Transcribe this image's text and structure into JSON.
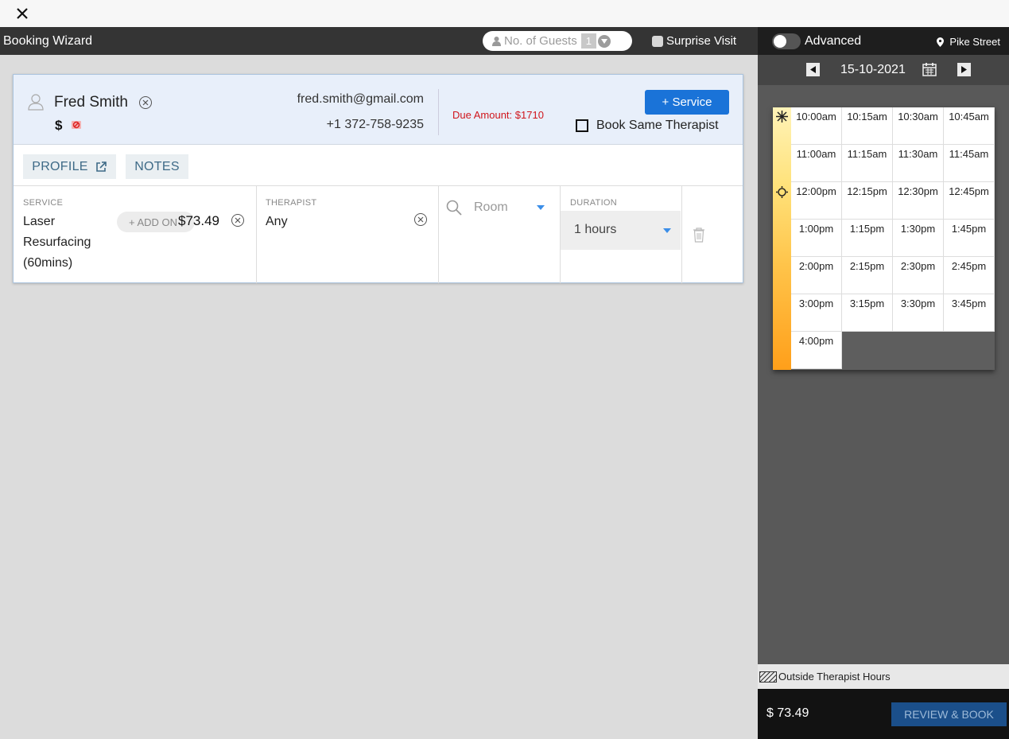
{
  "header": {
    "title": "Booking Wizard",
    "guests_label": "No. of Guests",
    "guests_value": "1",
    "surprise_label": "Surprise Visit"
  },
  "client": {
    "name": "Fred Smith",
    "currency_symbol": "$",
    "email": "fred.smith@gmail.com",
    "phone": "+1 372-758-9235",
    "due_amount": "Due Amount:  $1710",
    "service_button": "+ Service",
    "same_therapist": "Book Same Therapist",
    "profile_tab": "PROFILE",
    "notes_tab": "NOTES"
  },
  "booking": {
    "service_label": "SERVICE",
    "service_value": "Laser Resurfacing (60mins)",
    "addon_label": "+ ADD ON",
    "price": "$73.49",
    "therapist_label": "THERAPIST",
    "therapist_value": "Any",
    "room_placeholder": "Room",
    "duration_label": "DURATION",
    "duration_value": "1 hours"
  },
  "right": {
    "advanced": "Advanced",
    "location": "Pike Street",
    "date": "15-10-2021",
    "slots": [
      [
        "10:00am",
        "10:15am",
        "10:30am",
        "10:45am"
      ],
      [
        "11:00am",
        "11:15am",
        "11:30am",
        "11:45am"
      ],
      [
        "12:00pm",
        "12:15pm",
        "12:30pm",
        "12:45pm"
      ],
      [
        "1:00pm",
        "1:15pm",
        "1:30pm",
        "1:45pm"
      ],
      [
        "2:00pm",
        "2:15pm",
        "2:30pm",
        "2:45pm"
      ],
      [
        "3:00pm",
        "3:15pm",
        "3:30pm",
        "3:45pm"
      ],
      [
        "4:00pm"
      ]
    ],
    "legend": "Outside Therapist Hours",
    "total": "$ 73.49",
    "review_button": "REVIEW & BOOK"
  },
  "colors": {
    "primary": "#1a73d8",
    "due": "#d0161c",
    "header_bg": "#343434"
  }
}
